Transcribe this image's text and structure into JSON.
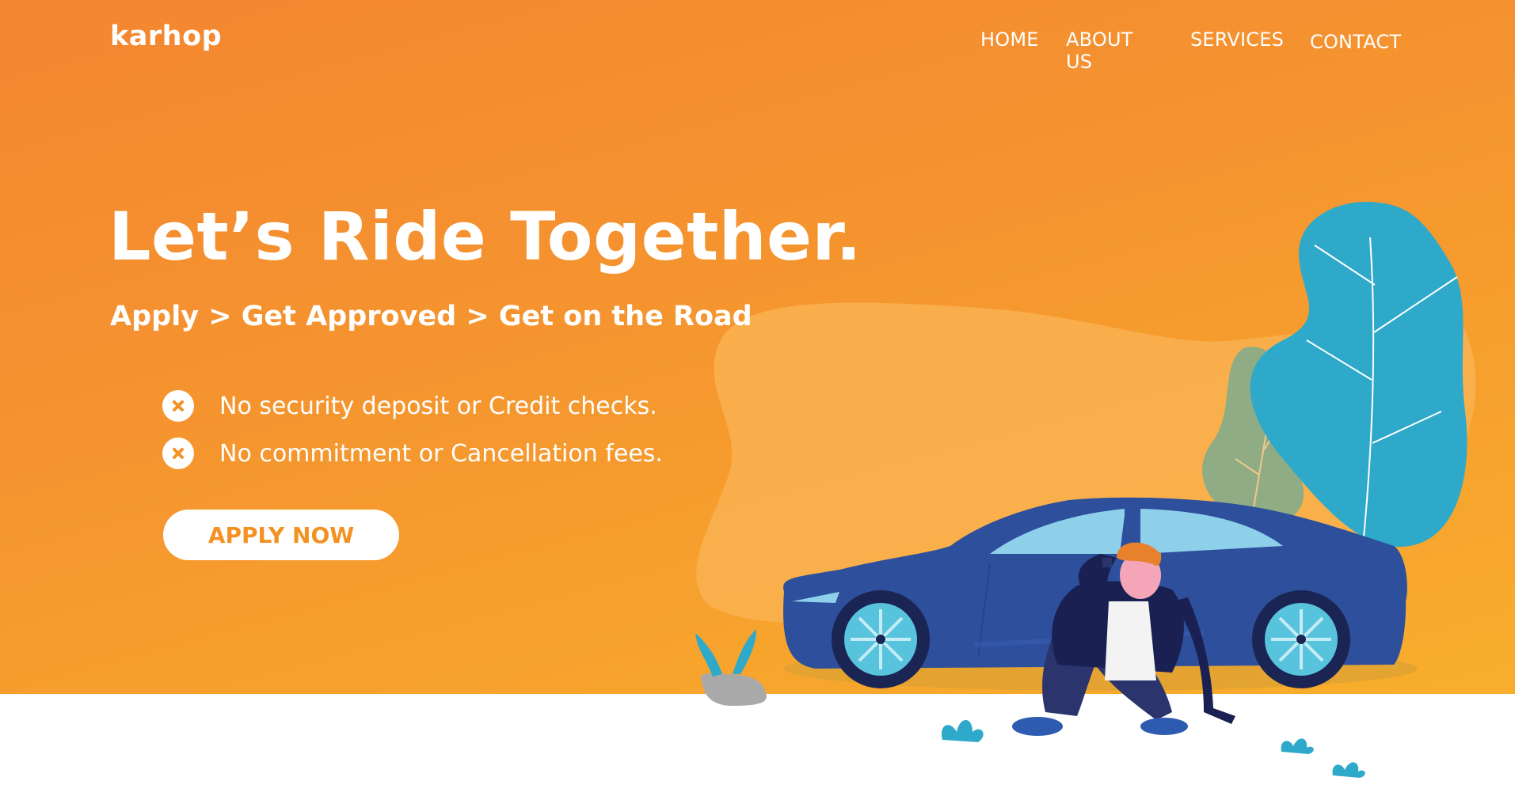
{
  "brand": {
    "logo": "karhop"
  },
  "nav": {
    "items": [
      {
        "label": "HOME"
      },
      {
        "label": "ABOUT US"
      },
      {
        "label": "SERVICES"
      },
      {
        "label": "CONTACT"
      }
    ]
  },
  "hero": {
    "headline": "Let’s Ride Together.",
    "subline": "Apply > Get Approved > Get on the Road",
    "features": [
      {
        "text": "No security deposit or Credit checks.",
        "icon": "x-circle-icon"
      },
      {
        "text": "No commitment or Cancellation fees.",
        "icon": "x-circle-icon"
      }
    ],
    "cta_label": "APPLY NOW"
  },
  "colors": {
    "gradient_start": "#f48631",
    "gradient_end": "#f8ae2c",
    "accent": "#f39223",
    "car_body": "#2d4f9c",
    "leaf": "#2da8c8"
  }
}
